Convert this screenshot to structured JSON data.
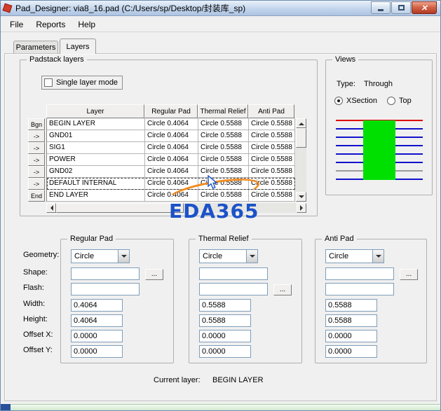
{
  "window": {
    "title": "Pad_Designer: via8_16.pad (C:/Users/sp/Desktop/封装库_sp)"
  },
  "menu": {
    "file": "File",
    "reports": "Reports",
    "help": "Help"
  },
  "tabs": {
    "parameters": "Parameters",
    "layers": "Layers",
    "active": "Layers"
  },
  "padstack": {
    "group_label": "Padstack layers",
    "single_layer_mode": {
      "label": "Single layer mode",
      "checked": false
    },
    "columns": {
      "layer": "Layer",
      "regular": "Regular Pad",
      "thermal": "Thermal Relief",
      "anti": "Anti Pad"
    },
    "rows": [
      {
        "nav": "Bgn",
        "layer": "BEGIN LAYER",
        "regular": "Circle 0.4064",
        "thermal": "Circle 0.5588",
        "anti": "Circle 0.5588",
        "selected": false
      },
      {
        "nav": "->",
        "layer": "GND01",
        "regular": "Circle 0.4064",
        "thermal": "Circle 0.5588",
        "anti": "Circle 0.5588",
        "selected": false
      },
      {
        "nav": "->",
        "layer": "SIG1",
        "regular": "Circle 0.4064",
        "thermal": "Circle 0.5588",
        "anti": "Circle 0.5588",
        "selected": false
      },
      {
        "nav": "->",
        "layer": "POWER",
        "regular": "Circle 0.4064",
        "thermal": "Circle 0.5588",
        "anti": "Circle 0.5588",
        "selected": false
      },
      {
        "nav": "->",
        "layer": "GND02",
        "regular": "Circle 0.4064",
        "thermal": "Circle 0.5588",
        "anti": "Circle 0.5588",
        "selected": false
      },
      {
        "nav": "->",
        "layer": "DEFAULT INTERNAL",
        "regular": "Circle 0.4064",
        "thermal": "Circle 0.5588",
        "anti": "Circle 0.5588",
        "selected": true
      },
      {
        "nav": "End",
        "layer": "END LAYER",
        "regular": "Circle 0.4064",
        "thermal": "Circle 0.5588",
        "anti": "Circle 0.5588",
        "selected": false
      }
    ]
  },
  "views": {
    "group_label": "Views",
    "type_label": "Type:",
    "type_value": "Through",
    "xsection_label": "XSection",
    "top_label": "Top",
    "selected": "XSection",
    "xsection": {
      "line_colors": [
        "#e00000",
        "#1111cc",
        "#1111cc",
        "#1111cc",
        "#1111cc",
        "#1111cc",
        "#9a9a9a",
        "#1111cc"
      ],
      "pad_color": "#00e000"
    }
  },
  "watermark": {
    "text": "EDA365",
    "color": "#1c52c8",
    "accent_color": "#f28b1e"
  },
  "pads": {
    "field_labels": [
      "Geometry:",
      "Shape:",
      "Flash:",
      "Width:",
      "Height:",
      "Offset X:",
      "Offset Y:"
    ],
    "browse_label": "...",
    "regular": {
      "label": "Regular Pad",
      "geometry": "Circle",
      "shape": "",
      "flash": "",
      "width": "0.4064",
      "height": "0.4064",
      "offset_x": "0.0000",
      "offset_y": "0.0000"
    },
    "thermal": {
      "label": "Thermal Relief",
      "geometry": "Circle",
      "shape": "",
      "flash": "",
      "width": "0.5588",
      "height": "0.5588",
      "offset_x": "0.0000",
      "offset_y": "0.0000"
    },
    "anti": {
      "label": "Anti Pad",
      "geometry": "Circle",
      "shape": "",
      "flash": "",
      "width": "0.5588",
      "height": "0.5588",
      "offset_x": "0.0000",
      "offset_y": "0.0000"
    }
  },
  "footer": {
    "current_layer_label": "Current layer:",
    "current_layer_value": "BEGIN LAYER"
  }
}
